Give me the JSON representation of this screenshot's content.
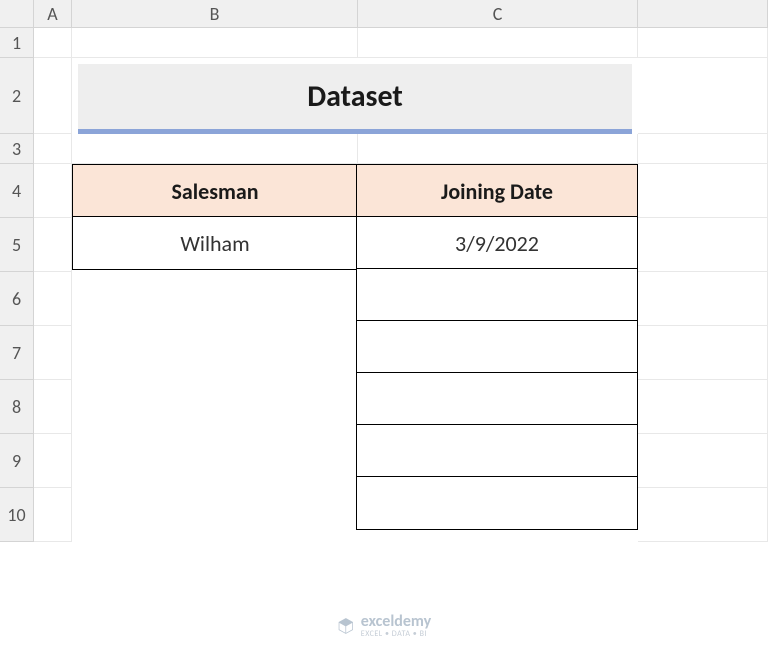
{
  "columns": [
    "A",
    "B",
    "C"
  ],
  "rows": [
    "1",
    "2",
    "3",
    "4",
    "5",
    "6",
    "7",
    "8",
    "9",
    "10"
  ],
  "title": "Dataset",
  "headers": {
    "salesman": "Salesman",
    "joining_date": "Joining Date"
  },
  "data": {
    "salesman": "Wilham",
    "joining_date": "3/9/2022"
  },
  "watermark": {
    "main": "exceldemy",
    "sub": "EXCEL • DATA • BI"
  },
  "chart_data": {
    "type": "table",
    "title": "Dataset",
    "columns": [
      "Salesman",
      "Joining Date"
    ],
    "rows": [
      [
        "Wilham",
        "3/9/2022"
      ],
      [
        "",
        ""
      ],
      [
        "",
        ""
      ],
      [
        "",
        ""
      ],
      [
        "",
        ""
      ],
      [
        "",
        ""
      ]
    ]
  }
}
